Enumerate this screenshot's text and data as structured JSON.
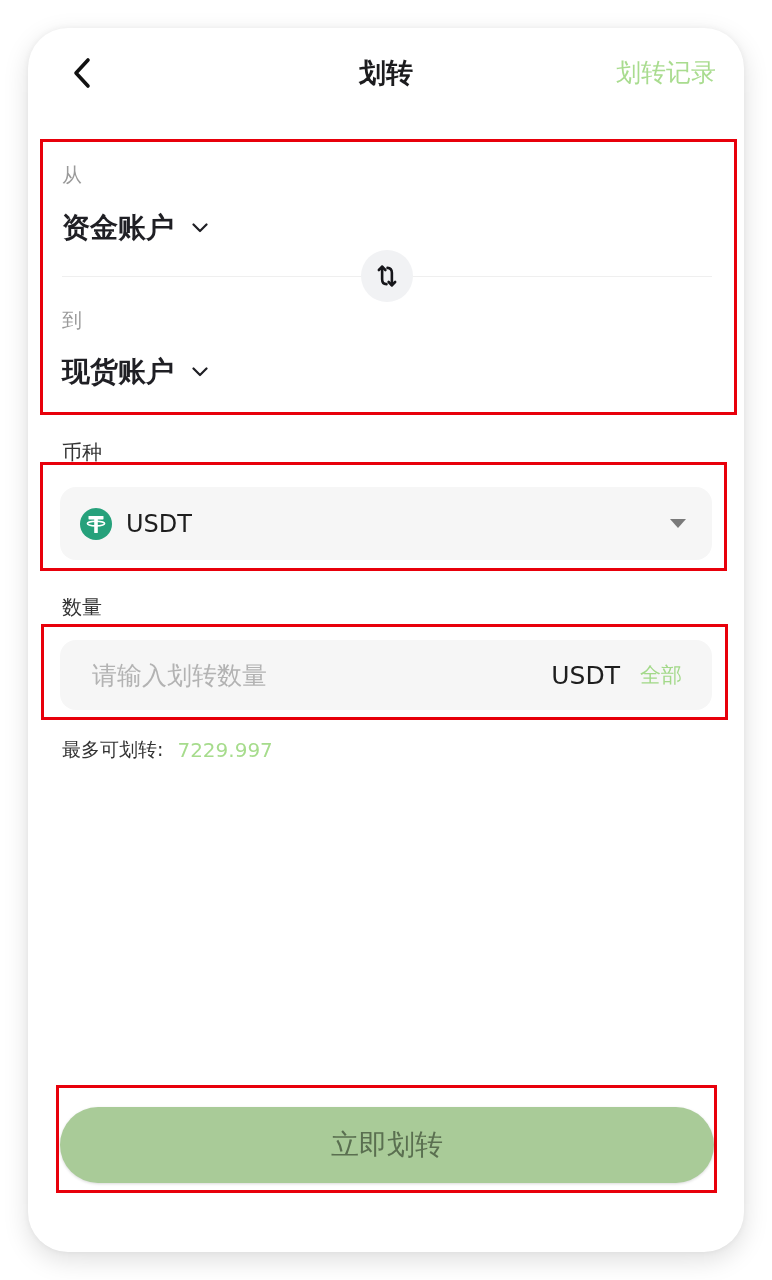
{
  "header": {
    "title": "划转",
    "history_link": "划转记录"
  },
  "transfer": {
    "from": {
      "label": "从",
      "account": "资金账户"
    },
    "to": {
      "label": "到",
      "account": "现货账户"
    }
  },
  "coin": {
    "label": "币种",
    "value": "USDT"
  },
  "amount": {
    "label": "数量",
    "placeholder": "请输入划转数量",
    "unit": "USDT",
    "max_button": "全部"
  },
  "available": {
    "label": "最多可划转:",
    "value": "7229.997"
  },
  "submit": {
    "label": "立即划转",
    "disabled": true
  }
}
